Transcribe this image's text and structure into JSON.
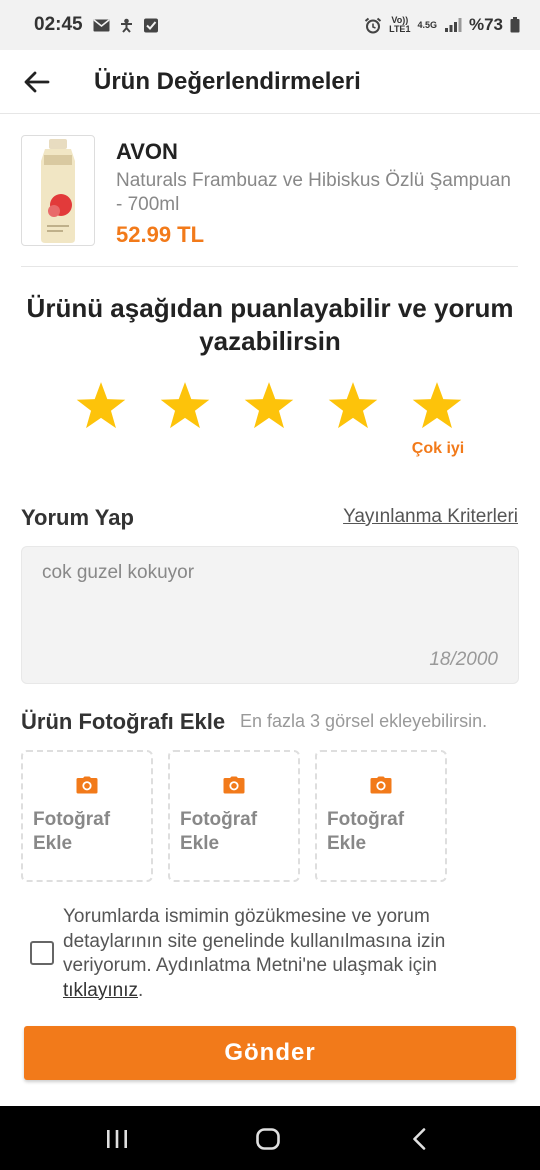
{
  "status_bar": {
    "time": "02:45",
    "network_top": "Vo))",
    "network_bottom": "LTE1",
    "network_type": "4.5G",
    "battery": "%73",
    "icons": [
      "mail-icon",
      "accessibility-icon",
      "checkbox-icon",
      "alarm-icon",
      "signal-icon",
      "battery-icon"
    ]
  },
  "header": {
    "title": "Ürün Değerlendirmeleri"
  },
  "product": {
    "brand": "AVON",
    "name": "Naturals Frambuaz ve Hibiskus Özlü Şampuan - 700ml",
    "price": "52.99 TL"
  },
  "rating": {
    "heading": "Ürünü aşağıdan puanlayabilir ve yorum yazabilirsin",
    "value": 5,
    "max": 5,
    "label": "Çok iyi"
  },
  "review": {
    "title": "Yorum Yap",
    "criteria_link": "Yayınlanma Kriterleri",
    "text": "cok guzel kokuyor",
    "counter": "18/2000"
  },
  "photos": {
    "title": "Ürün Fotoğrafı Ekle",
    "hint": "En fazla 3 görsel ekleyebilirsin.",
    "slots": [
      {
        "label": "Fotoğraf Ekle"
      },
      {
        "label": "Fotoğraf Ekle"
      },
      {
        "label": "Fotoğraf Ekle"
      }
    ]
  },
  "consent": {
    "text": "Yorumlarda ismimin gözükmesine ve yorum detaylarının site genelinde kullanılmasına izin veriyorum. Aydınlatma Metni'ne ulaşmak için",
    "link": "tıklayınız",
    "suffix": ".",
    "checked": false
  },
  "submit": {
    "label": "Gönder"
  },
  "colors": {
    "accent": "#f27a1a",
    "star": "#fdc30a",
    "background": "#ffffff",
    "input_background": "#f3f3f3",
    "nav_background": "#000000"
  }
}
